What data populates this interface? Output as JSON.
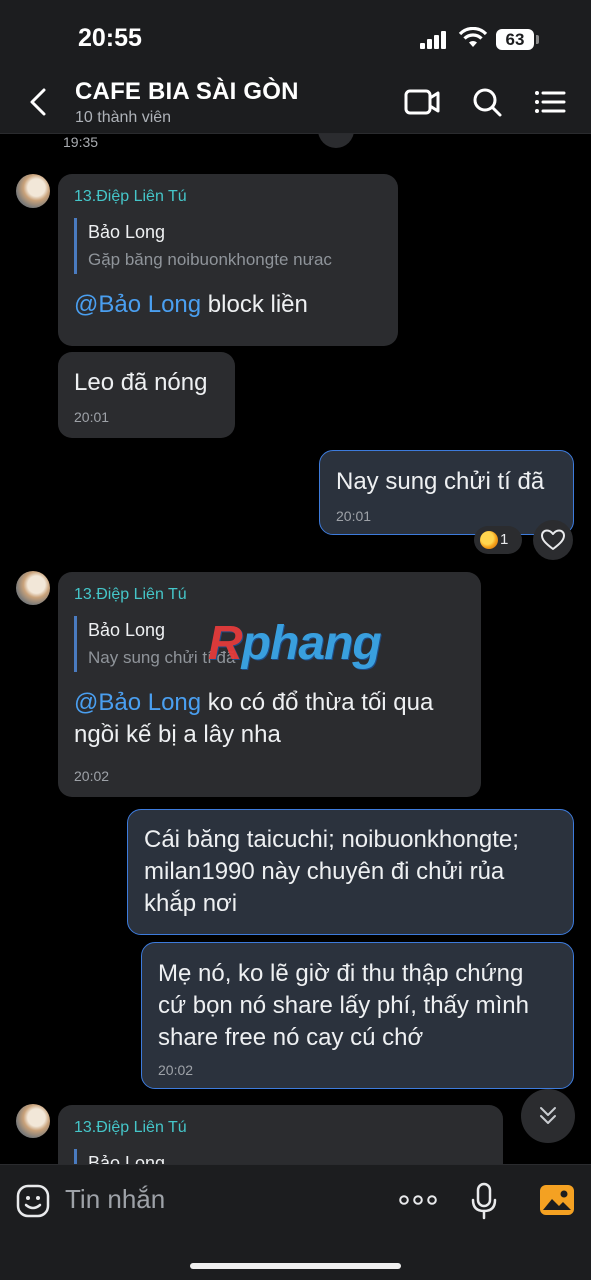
{
  "status": {
    "time": "20:55",
    "battery": "63"
  },
  "header": {
    "title": "CAFE BIA SÀI GÒN",
    "subtitle": "10 thành viên"
  },
  "chat": {
    "top_timestamp": "19:35",
    "messages": [
      {
        "sender": "13.Điệp Liên Tú",
        "quote_name": "Bảo Long",
        "quote_text": "Gặp băng noibuonkhongte nưac",
        "mention": "@Bảo Long",
        "text": " block liền"
      },
      {
        "text": "Leo đã nóng",
        "time": "20:01"
      },
      {
        "text": "Nay sung chửi tí đã",
        "time": "20:01",
        "reaction_count": "1"
      },
      {
        "sender": "13.Điệp Liên Tú",
        "quote_name": "Bảo Long",
        "quote_text": "Nay sung chửi tí đã",
        "mention": "@Bảo Long",
        "text_line1": " ko có đổ thừa tối qua",
        "text_line2": "ngồi kế bị a lây nha",
        "time": "20:02"
      },
      {
        "line1": "Cái băng taicuchi; noibuonkhongte;",
        "line2": "milan1990 này chuyên đi chửi rủa",
        "line3": "khắp nơi"
      },
      {
        "line1": "Mẹ nó, ko lẽ giờ đi thu thập chứng",
        "line2": "cứ bọn nó share lấy phí, thấy mình",
        "line3": "share free nó cay cú chớ",
        "time": "20:02"
      },
      {
        "sender": "13.Điệp Liên Tú",
        "quote_name": "Bảo Long"
      }
    ],
    "watermark_r": "R",
    "watermark_rest": "phang"
  },
  "input": {
    "placeholder": "Tin nhắn"
  },
  "colors": {
    "accent": "#3d7bdc",
    "sender": "#45c6c9",
    "mention": "#4a9ff0",
    "background": "#000000",
    "bar": "#1c1d1f"
  },
  "icons": [
    "back-icon",
    "video-call-icon",
    "search-icon",
    "menu-icon",
    "heart-icon",
    "chevron-down-icon",
    "sticker-icon",
    "more-icon",
    "mic-icon",
    "image-icon"
  ]
}
